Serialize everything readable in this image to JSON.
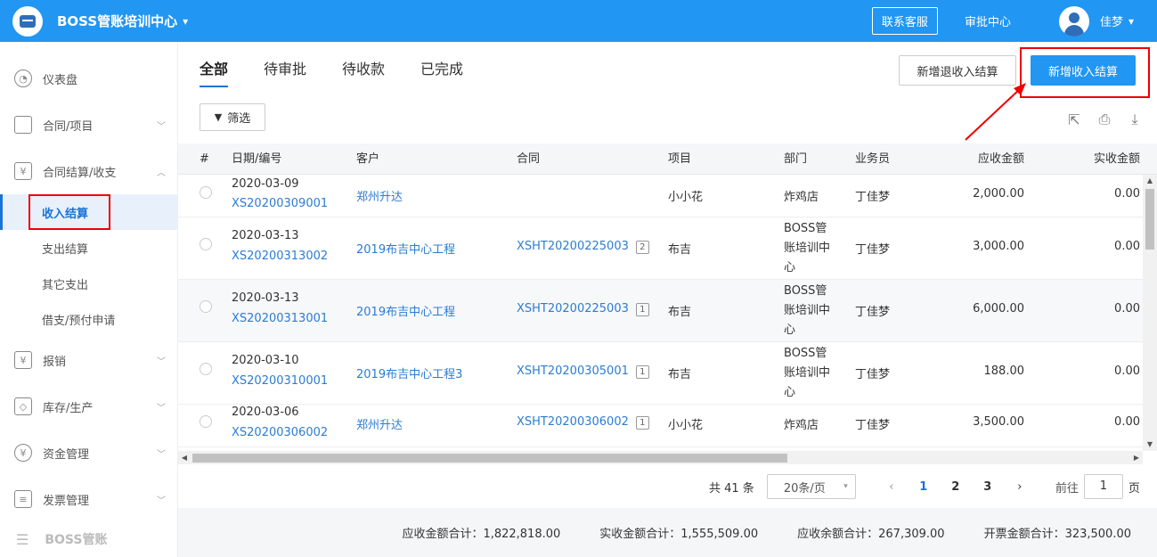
{
  "header": {
    "company": "BOSS管账培训中心",
    "contact_btn": "联系客服",
    "approval_link": "审批中心",
    "username": "佳梦"
  },
  "sidebar": {
    "items": [
      {
        "label": "仪表盘",
        "icon": "dashboard-icon"
      },
      {
        "label": "合同/项目",
        "icon": "folder-icon"
      },
      {
        "label": "合同结算/收支",
        "icon": "settlement-icon"
      },
      {
        "label": "报销",
        "icon": "reimburse-icon"
      },
      {
        "label": "库存/生产",
        "icon": "box-icon"
      },
      {
        "label": "资金管理",
        "icon": "money-icon"
      },
      {
        "label": "发票管理",
        "icon": "invoice-icon"
      }
    ],
    "sub_items": [
      "收入结算",
      "支出结算",
      "其它支出",
      "借支/预付申请"
    ],
    "footer": "BOSS管账"
  },
  "tabs": [
    "全部",
    "待审批",
    "待收款",
    "已完成"
  ],
  "actions": {
    "refund_btn": "新增退收入结算",
    "add_btn": "新增收入结算",
    "filter_btn": "筛选"
  },
  "table": {
    "headers": [
      "#",
      "日期/编号",
      "客户",
      "合同",
      "项目",
      "部门",
      "业务员",
      "应收金额",
      "实收金额"
    ],
    "rows": [
      {
        "date": "2020-03-09",
        "code": "XS20200309001",
        "customer": "郑州升达",
        "contract": "",
        "badge": "",
        "project": "小小花",
        "dept": [
          "炸鸡店"
        ],
        "sales": "丁佳梦",
        "receivable": "2,000.00",
        "received": "0.00"
      },
      {
        "date": "2020-03-13",
        "code": "XS20200313002",
        "customer": "2019布吉中心工程",
        "contract": "XSHT20200225003",
        "badge": "2",
        "project": "布吉",
        "dept": [
          "BOSS管",
          "账培训中",
          "心"
        ],
        "sales": "丁佳梦",
        "receivable": "3,000.00",
        "received": "0.00"
      },
      {
        "date": "2020-03-13",
        "code": "XS20200313001",
        "customer": "2019布吉中心工程",
        "contract": "XSHT20200225003",
        "badge": "1",
        "project": "布吉",
        "dept": [
          "BOSS管",
          "账培训中",
          "心"
        ],
        "sales": "丁佳梦",
        "receivable": "6,000.00",
        "received": "0.00"
      },
      {
        "date": "2020-03-10",
        "code": "XS20200310001",
        "customer": "2019布吉中心工程3",
        "contract": "XSHT20200305001",
        "badge": "1",
        "project": "布吉",
        "dept": [
          "BOSS管",
          "账培训中",
          "心"
        ],
        "sales": "丁佳梦",
        "receivable": "188.00",
        "received": "0.00"
      },
      {
        "date": "2020-03-06",
        "code": "XS20200306002",
        "customer": "郑州升达",
        "contract": "XSHT20200306002",
        "badge": "1",
        "project": "小小花",
        "dept": [
          "炸鸡店"
        ],
        "sales": "丁佳梦",
        "receivable": "3,500.00",
        "received": "0.00"
      }
    ]
  },
  "pagination": {
    "total": "共 41 条",
    "page_size": "20条/页",
    "pages": [
      "1",
      "2",
      "3"
    ],
    "current": "1",
    "goto_label": "前往",
    "goto_value": "1",
    "page_suffix": "页"
  },
  "summary": {
    "receivable_total": "应收金额合计：1,822,818.00",
    "received_total": "实收金额合计：1,555,509.00",
    "balance_total": "应收余额合计：267,309.00",
    "invoice_total": "开票金额合计：323,500.00"
  },
  "colors": {
    "primary": "#2196f3",
    "link": "#2b7cd3",
    "highlight": "#e00000"
  }
}
